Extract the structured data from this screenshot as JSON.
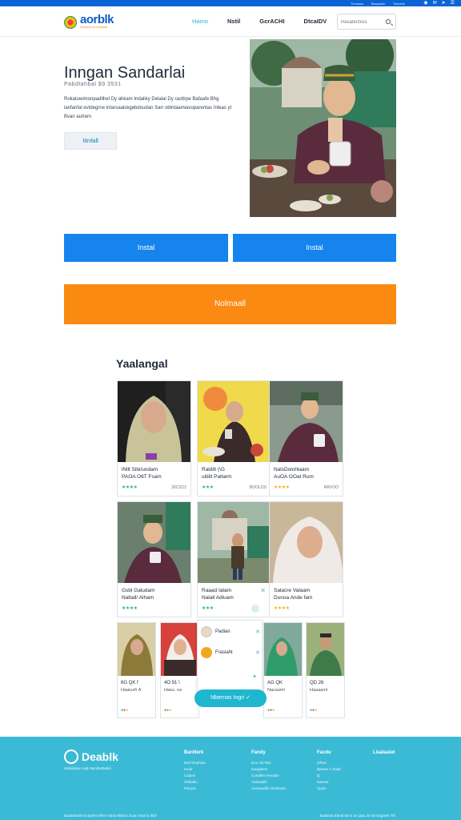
{
  "topbar": {
    "links": [
      "Tremaaa",
      "Bwagnaln",
      "Teavelln"
    ],
    "icons": [
      "bell-icon",
      "mail-icon",
      "share-icon",
      "menu-icon"
    ]
  },
  "header": {
    "logo_name": "aorblk",
    "logo_tagline": "Sebabak bio Samadia",
    "nav": [
      {
        "label": "Hamo",
        "active": true
      },
      {
        "label": "Nstil",
        "active": false
      },
      {
        "label": "GcrACHI",
        "active": false
      },
      {
        "label": "DtcaIDV",
        "active": false
      }
    ],
    "search_placeholder": "Resatechiss"
  },
  "hero": {
    "title": "Inngan Sandarlai",
    "subtitle": "Pabdtahbal $9 3531",
    "body": "Rokatuwimonpadilhel Dy ahkam Indaliky Delalai Dy rasttrpe Bafaafe Bhg lanfanfal evtdegrne intarsaalskgebdoudan Sarr oblntaamiavoparentas Inleas yt Bvan aurlarn",
    "button": "Iitnfall"
  },
  "actions": {
    "blue_1": "Instal",
    "blue_2": "Instal",
    "orange": "Nolmaall"
  },
  "gallery": {
    "title": "Yaalangal",
    "cards": [
      {
        "line1": "lNllt Sibi/undam",
        "line2": "PAOA O6T Fsam",
        "meta": "30C2/12",
        "star_color": "#2fb67a"
      },
      {
        "line1": "Raldilt (\\G",
        "line2": "uldilt Paltarm",
        "meta": "BOOLOS",
        "star_color": "#2fb67a"
      },
      {
        "line1": "NalsDolohlaam",
        "line2": "AuOA OOat Rum",
        "meta": "RRVOO",
        "star_color": "#f2b01e"
      },
      {
        "line1": "Gsbl Galudam",
        "line2": "Nattall/ Alham",
        "meta": "",
        "star_color": "#2fb67a"
      },
      {
        "line1": "Raaad Iatam",
        "line2": "Nalall Adluam",
        "meta": "",
        "star_color": "#2fb67a"
      },
      {
        "line1": "Salacre Valaam",
        "line2": "Dunoa Ande fam",
        "meta": "",
        "star_color": "#f2b01e"
      }
    ],
    "small_cards": [
      {
        "line1": "6G QK f",
        "line2": "Haaiusfr A",
        "dots": [
          "#2fb67a",
          "#e24545",
          "#f2b01e"
        ]
      },
      {
        "line1": "4O 91 \\",
        "line2": "Hasu. na",
        "dots": [
          "#e24545",
          "#2fb67a",
          "#f2b01e"
        ]
      },
      {
        "line1": "AG QK",
        "line2": "Nacaaml",
        "dots": [
          "#2fb67a",
          "#e24545",
          "#f2b01e"
        ]
      },
      {
        "line1": "QD 26",
        "line2": "Haaaaml",
        "dots": [
          "#2fb67a",
          "#e24545",
          "#f2b01e"
        ]
      }
    ]
  },
  "popup": {
    "rows": [
      "Padian",
      "Frasiaht"
    ],
    "pill": "Nbernas Ingri"
  },
  "footer": {
    "logo_name": "Deablk",
    "tagline": "Sebalakan rogh Benbletbaliol",
    "columns": [
      {
        "heading": "Bardlerk",
        "items": [
          "Bovl Reahlaa",
          "Hvok",
          "Cadeni",
          "Ohtlalbo",
          "Pavosu"
        ]
      },
      {
        "heading": "Fandy",
        "items": [
          "Duu Oit Ras",
          "Eangdenz",
          "Cotrdlen Rensdie",
          "Vrafasalls",
          "Aoonsadbil Ghelnoon"
        ]
      },
      {
        "heading": "Facdu",
        "items": [
          "Oftow",
          "Bemen C Ibiab",
          "Q",
          "Eaenet",
          "Cpolv"
        ]
      },
      {
        "heading": "Llaalaalat",
        "items": []
      }
    ],
    "bottom_left": "Boaladrede Enaphet trliere Sbrla Bkbta Lhuan Sed fo Sbd",
    "bottom_right": "Baahraa Ebeal lamn as Qaa.Je IDI Eagewe 7Ih"
  }
}
